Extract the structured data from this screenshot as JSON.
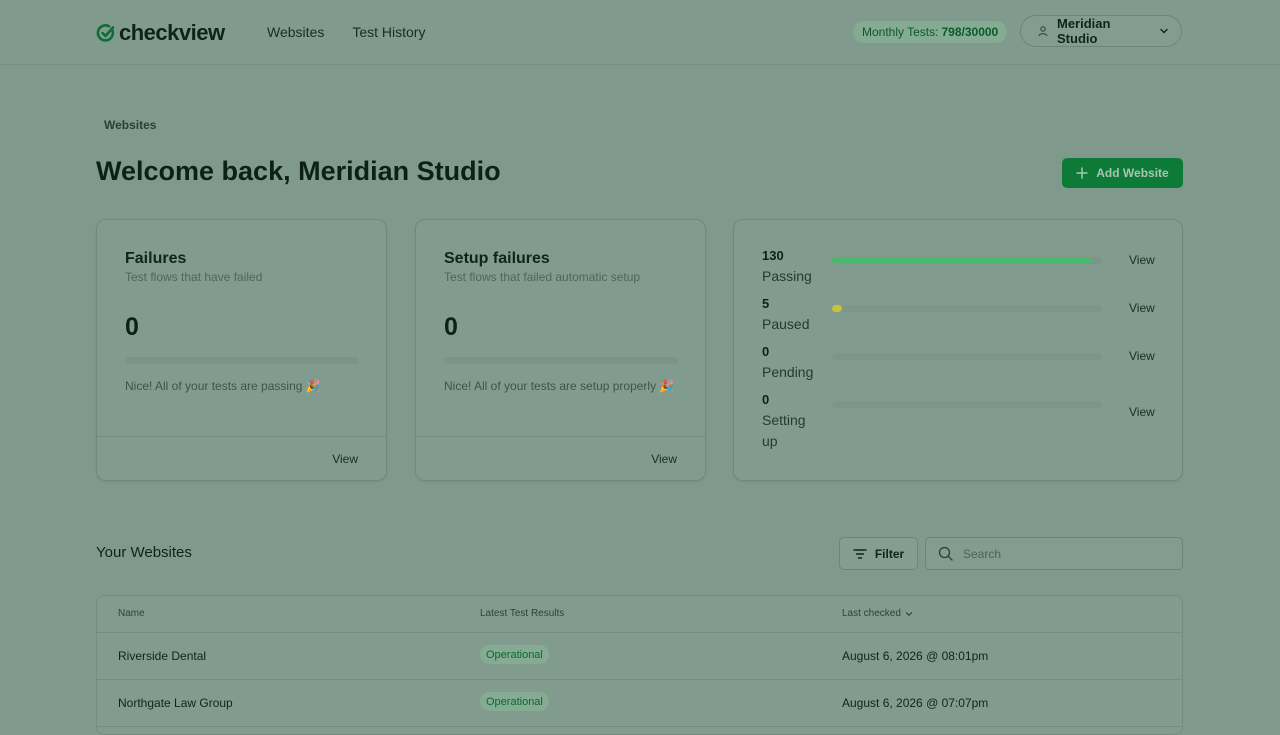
{
  "app": {
    "brand": "checkview",
    "nav": [
      "Websites",
      "Test History"
    ],
    "usage": {
      "label": "Monthly Tests:",
      "value": "798/30000"
    },
    "account": {
      "name": "Meridian Studio"
    }
  },
  "page": {
    "breadcrumb": "Websites",
    "title": "Welcome back, Meridian Studio",
    "add_button": "Add Website"
  },
  "cards": [
    {
      "title": "Failures",
      "subtitle": "Test flows that have failed",
      "value": "0",
      "message": "Nice! All of your tests are passing 🎉",
      "view": "View"
    },
    {
      "title": "Setup failures",
      "subtitle": "Test flows that failed automatic setup",
      "value": "0",
      "message": "Nice! All of your tests are setup properly 🎉",
      "view": "View"
    }
  ],
  "status": [
    {
      "count": "130",
      "label": "Passing",
      "fraction": 0.96,
      "color": "#4bb870",
      "view": "View"
    },
    {
      "count": "5",
      "label": "Paused",
      "fraction": 0.037,
      "color": "#c8c23a",
      "view": "View"
    },
    {
      "count": "0",
      "label": "Pending",
      "fraction": 0,
      "color": "#4bb870",
      "view": "View"
    },
    {
      "count": "0",
      "label": "Setting up",
      "fraction": 0,
      "color": "#4bb870",
      "view": "View"
    }
  ],
  "websites": {
    "title": "Your Websites",
    "filter_label": "Filter",
    "search_placeholder": "Search",
    "columns": [
      "Name",
      "Latest Test Results",
      "Last checked"
    ],
    "rows": [
      {
        "name": "Riverside Dental",
        "result": "Operational",
        "checked": "August 6, 2026 @ 08:01pm"
      },
      {
        "name": "Northgate Law Group",
        "result": "Operational",
        "checked": "August 6, 2026 @ 07:07pm"
      }
    ]
  },
  "colors": {
    "accent": "#0e7a38",
    "operational": "#0a6a2f"
  }
}
